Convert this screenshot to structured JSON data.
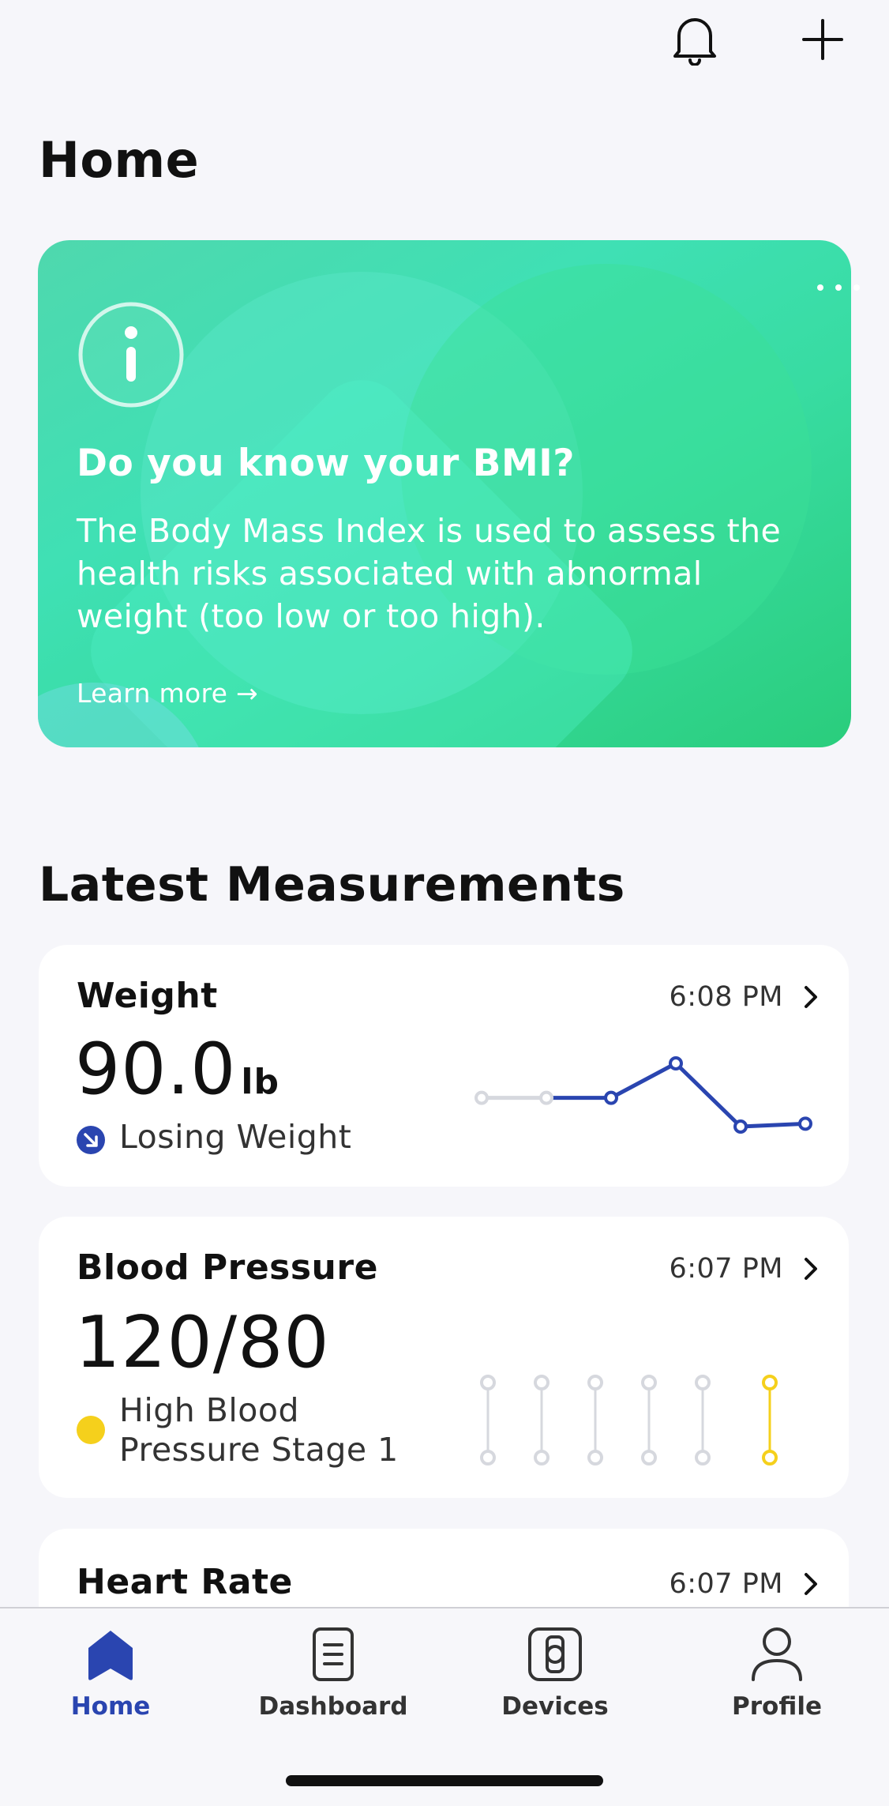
{
  "header": {
    "title": "Home",
    "notification_icon": "bell-icon",
    "add_icon": "plus-icon"
  },
  "bmi_card": {
    "icon": "info-icon",
    "more_icon": "more-dots-icon",
    "title": "Do you know your BMI?",
    "body": "The Body Mass Index is used to assess the health risks associated with abnormal weight (too low or too high).",
    "link": "Learn more →",
    "gradient_colors": [
      "#4FD8AE",
      "#2ACD7C"
    ]
  },
  "latest": {
    "title": "Latest Measurements",
    "weight": {
      "title": "Weight",
      "time": "6:08 PM",
      "value": "90.0",
      "unit": "lb",
      "status": "Losing Weight",
      "status_color": "#2A45B0",
      "trend_values": [
        90.6,
        90.6,
        90.6,
        91.2,
        90.1,
        90.15
      ]
    },
    "blood_pressure": {
      "title": "Blood Pressure",
      "time": "6:07 PM",
      "value": "120/80",
      "status_line1": "High Blood",
      "status_line2": "Pressure Stage 1",
      "status_color": "#F5D01C",
      "readings": 6
    },
    "heart_rate": {
      "title": "Heart Rate",
      "time": "6:07 PM"
    }
  },
  "nav": {
    "items": [
      {
        "label": "Home",
        "icon": "home-icon",
        "active": true
      },
      {
        "label": "Dashboard",
        "icon": "dashboard-icon",
        "active": false
      },
      {
        "label": "Devices",
        "icon": "devices-icon",
        "active": false
      },
      {
        "label": "Profile",
        "icon": "profile-icon",
        "active": false
      }
    ],
    "active_color": "#2A45B0"
  }
}
